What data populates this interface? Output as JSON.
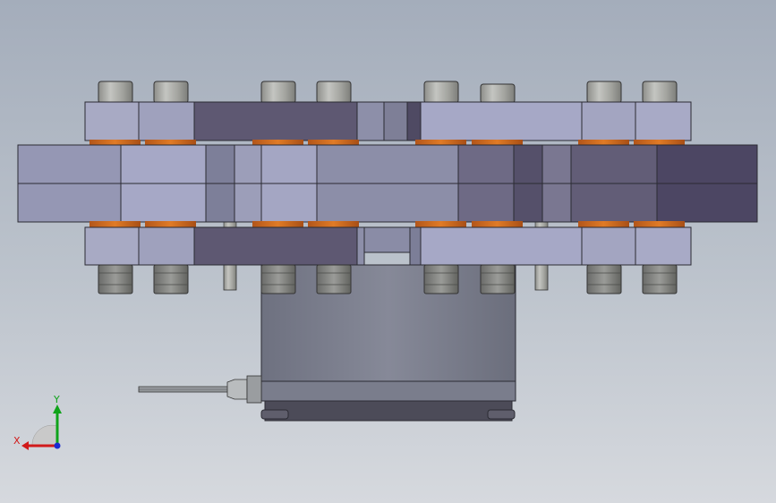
{
  "viewport": {
    "triad": {
      "x_label": "X",
      "y_label": "Y",
      "colors": {
        "x": "#d11a1a",
        "y": "#0fa31a",
        "z": "#1a2ad1"
      }
    }
  },
  "colors": {
    "bolt_head": "#a9aaa6",
    "nut": "#7e7f7c",
    "washer": "#cf6a1c",
    "plate_light": "#a6a8c6",
    "plate_mid": "#8c8ea8",
    "plate_dark": "#5e5872",
    "plate_darker": "#4c4663",
    "box": "#7e8190",
    "box_bottom": "#4a4a56",
    "probe": "#8f9396"
  }
}
